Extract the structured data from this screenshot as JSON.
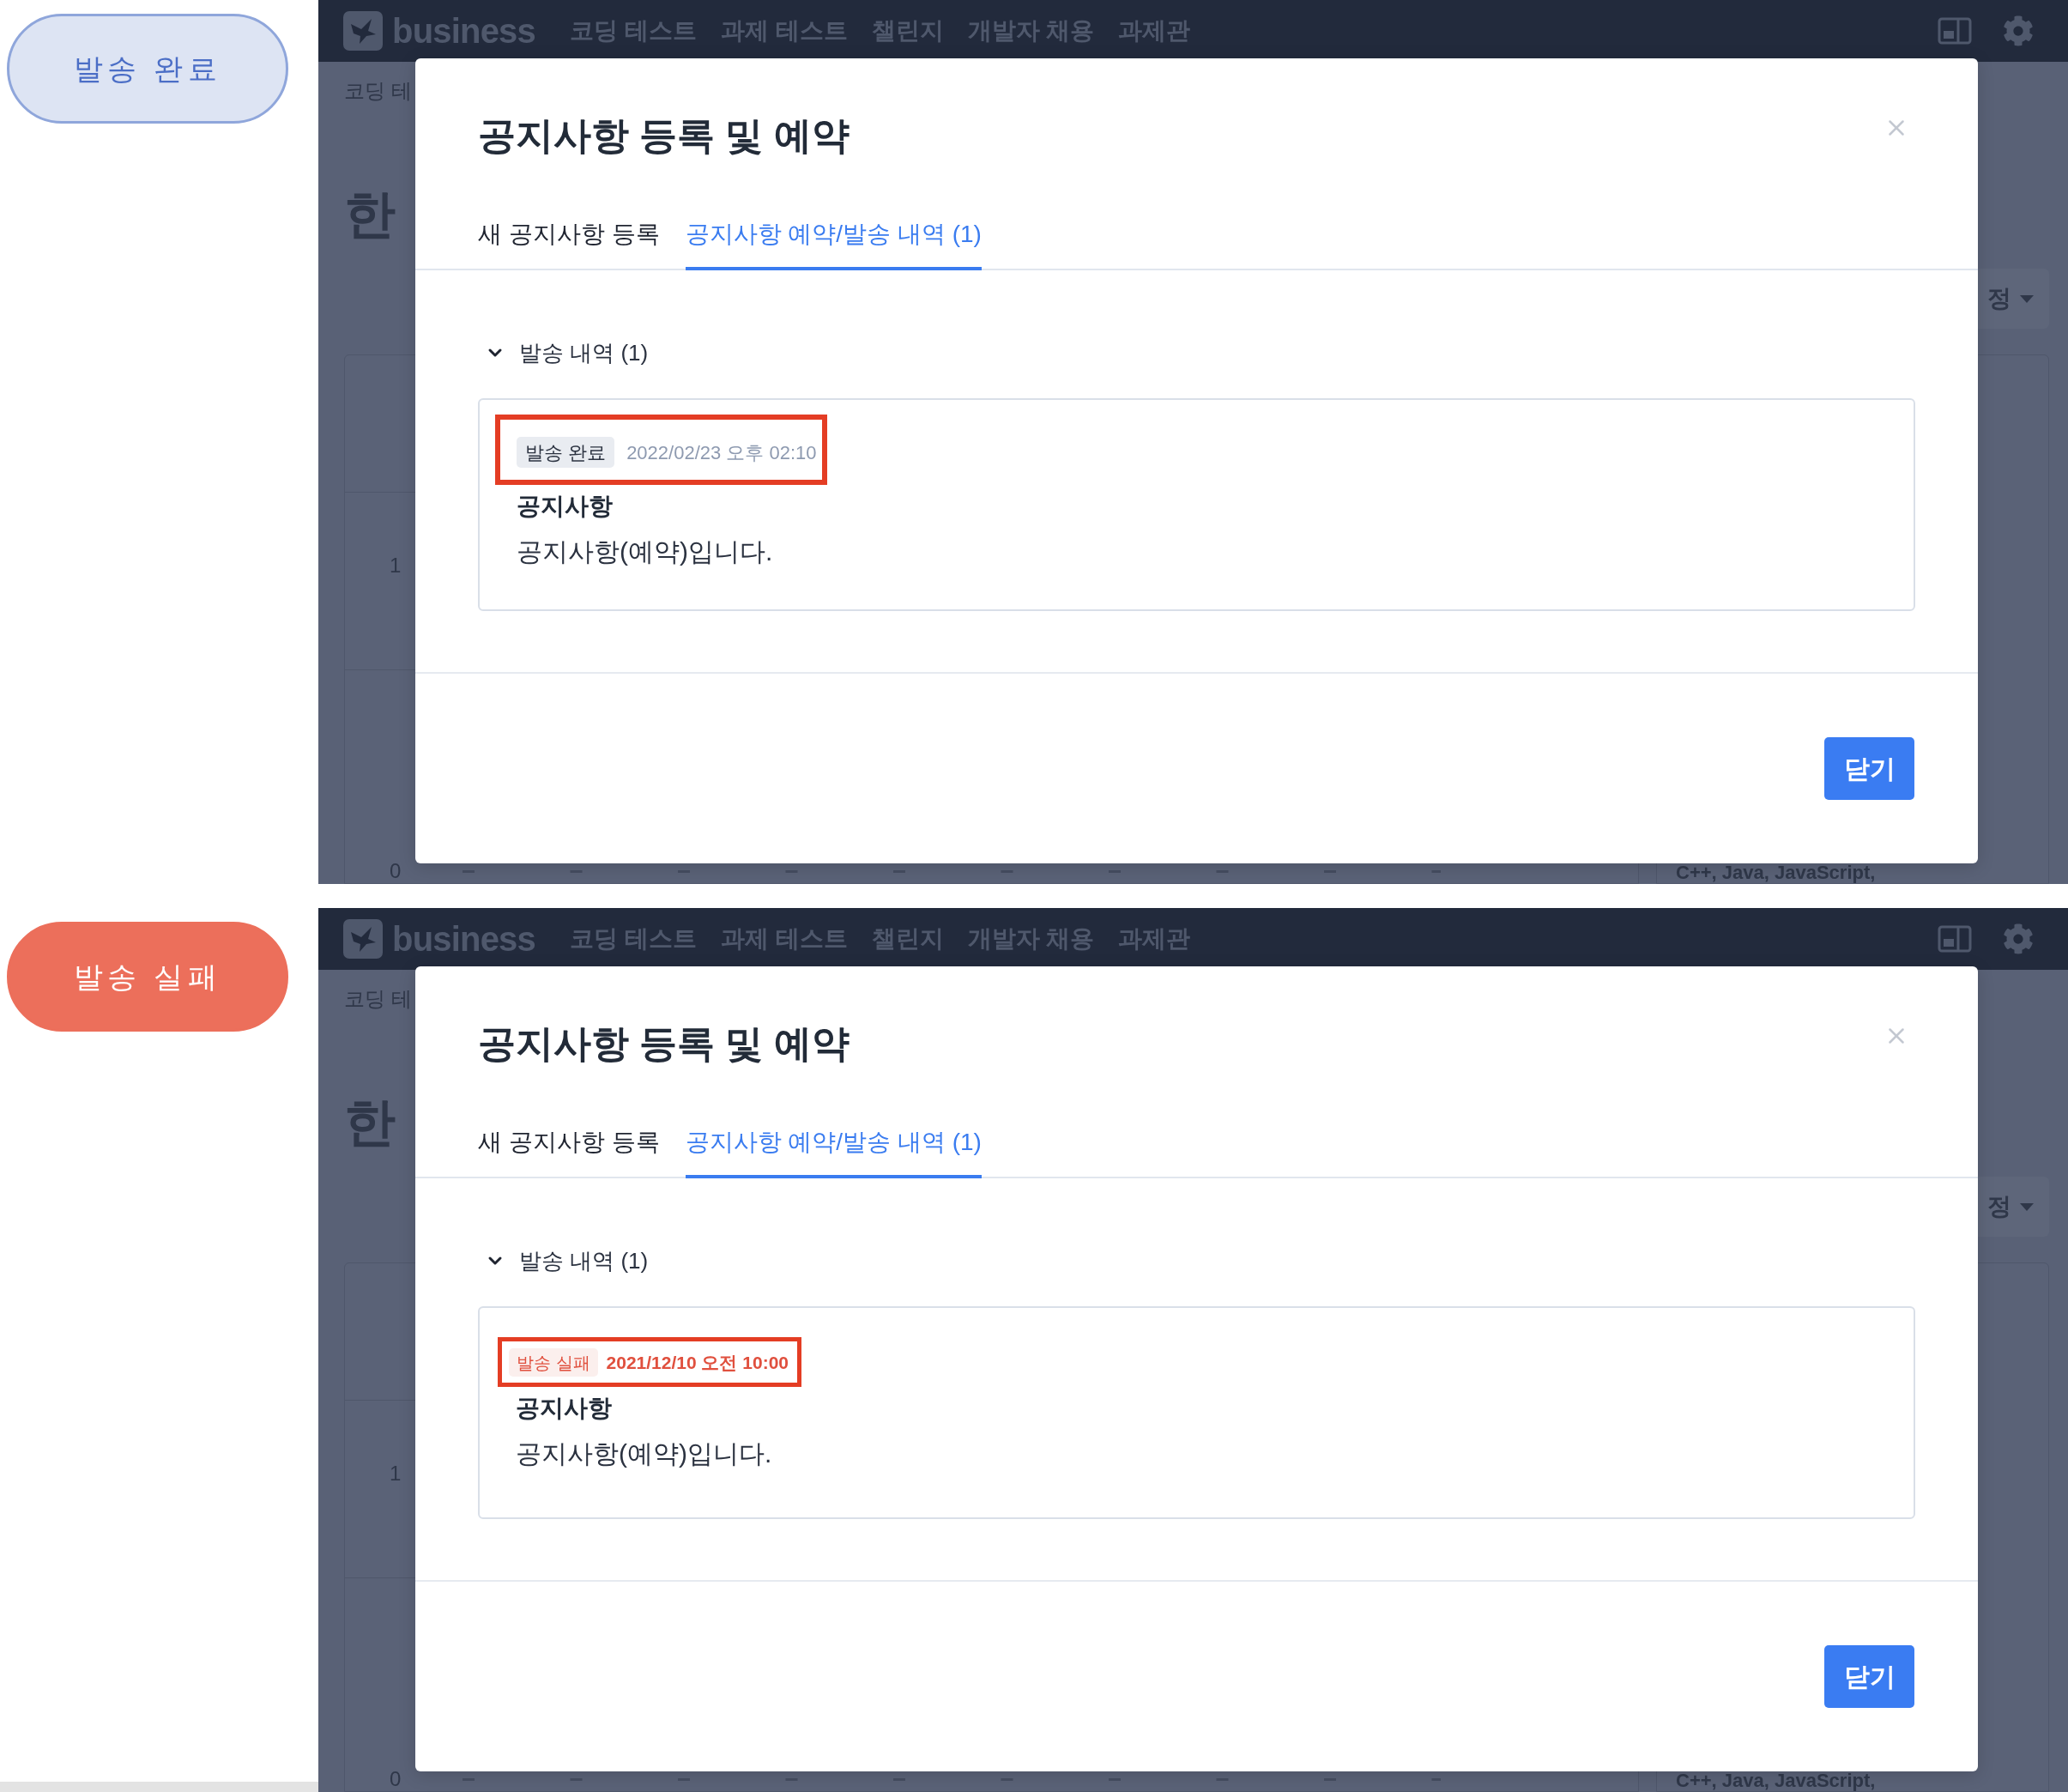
{
  "panels": [
    {
      "status_pill": {
        "label": "발송 완료",
        "kind": "sent"
      },
      "app": {
        "logo": "business",
        "nav_items": [
          "코딩 테스트",
          "과제 테스트",
          "챌린지",
          "개발자 채용",
          "과제관"
        ],
        "breadcrumb": "코딩 테",
        "heading": "한",
        "dropdown": "정",
        "y_labels": [
          "1",
          "0"
        ],
        "card_text": "C++, Java, JavaScript,"
      },
      "modal": {
        "title": "공지사항 등록 및 예약",
        "tabs": [
          {
            "label": "새 공지사항 등록",
            "selected": false
          },
          {
            "label": "공지사항 예약/발송 내역 (1)",
            "selected": true
          }
        ],
        "history": {
          "label": "발송 내역 (1)",
          "expanded": true,
          "items": [
            {
              "kind": "sent",
              "status": "발송 완료",
              "time": "2022/02/23 오후 02:10",
              "highlighted": true,
              "title": "공지사항",
              "body": "공지사항(예약)입니다."
            }
          ]
        },
        "close_button": "닫기"
      }
    },
    {
      "status_pill": {
        "label": "발송 실패",
        "kind": "failed"
      },
      "app": {
        "logo": "business",
        "nav_items": [
          "코딩 테스트",
          "과제 테스트",
          "챌린지",
          "개발자 채용",
          "과제관"
        ],
        "breadcrumb": "코딩 테",
        "heading": "한",
        "dropdown": "정",
        "y_labels": [
          "1",
          "0"
        ],
        "card_text": "C++, Java, JavaScript,"
      },
      "modal": {
        "title": "공지사항 등록 및 예약",
        "tabs": [
          {
            "label": "새 공지사항 등록",
            "selected": false
          },
          {
            "label": "공지사항 예약/발송 내역 (1)",
            "selected": true
          }
        ],
        "history": {
          "label": "발송 내역 (1)",
          "expanded": true,
          "items": [
            {
              "kind": "failed",
              "status": "발송 실패",
              "time": "2021/12/10 오전 10:00",
              "highlighted": true,
              "title": "공지사항",
              "body": "공지사항(예약)입니다."
            }
          ]
        },
        "close_button": "닫기"
      }
    }
  ]
}
